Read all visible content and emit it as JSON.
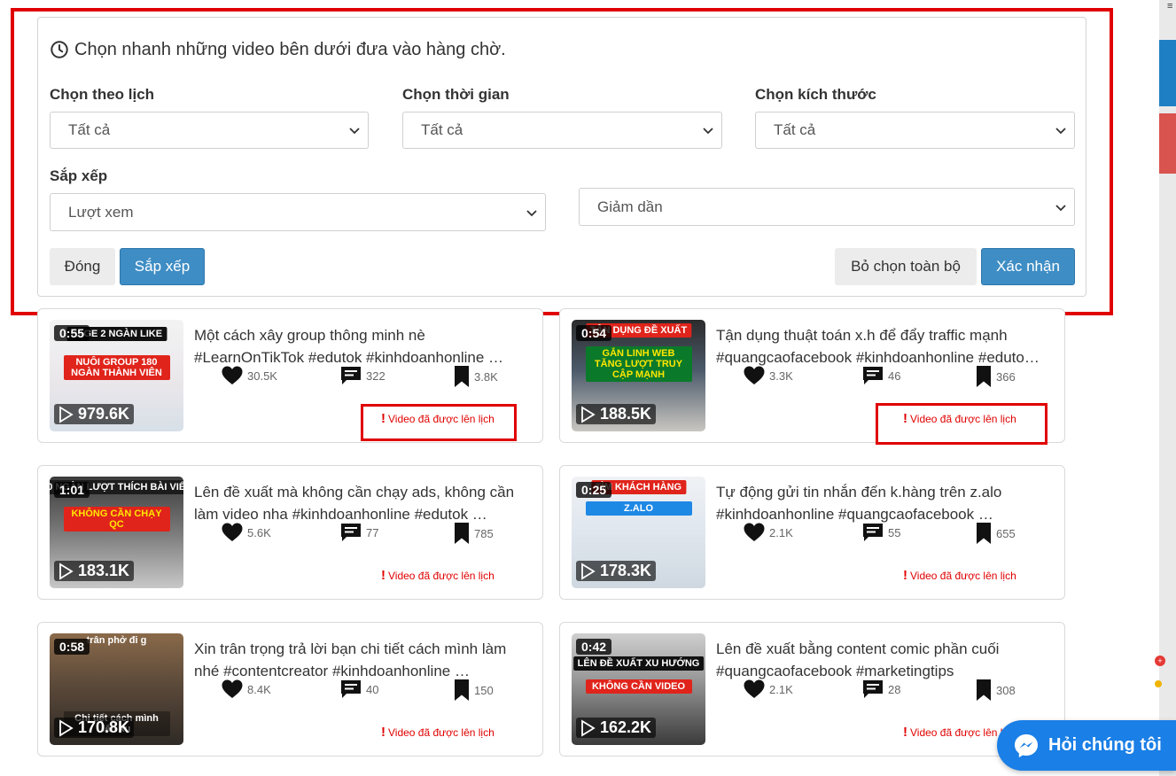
{
  "panel": {
    "title": "Chọn nhanh những video bên dưới đưa vào hàng chờ.",
    "filters": {
      "calendar_label": "Chọn theo lịch",
      "calendar_value": "Tất cả",
      "time_label": "Chọn thời gian",
      "time_value": "Tất cả",
      "size_label": "Chọn kích thước",
      "size_value": "Tất cả",
      "sort_label": "Sắp xếp",
      "sort_by_value": "Lượt xem",
      "sort_order_value": "Giảm dần"
    },
    "buttons": {
      "close": "Đóng",
      "sort": "Sắp xếp",
      "deselect_all": "Bỏ chọn toàn bộ",
      "confirm": "Xác nhận"
    }
  },
  "videos": [
    {
      "duration": "0:55",
      "views": "979.6K",
      "title_line1": "Một cách xây group thông minh nè",
      "title_line2": "#LearnOnTikTok #edutok #kinhdoanhonline …",
      "likes": "30.5K",
      "comments": "322",
      "saves": "3.8K",
      "status": "Video đã được lên lịch",
      "overlay_top": "PAGE 2 NGÀN LIKE",
      "overlay_mid": "NUÔI GROUP 180 NGÀN THÀNH VIÊN"
    },
    {
      "duration": "0:54",
      "views": "188.5K",
      "title_line1": "Tận dụng thuật toán x.h để đẩy traffic mạnh",
      "title_line2": "#quangcaofacebook #kinhdoanhonline #eduto…",
      "likes": "3.3K",
      "comments": "46",
      "saves": "366",
      "status": "Video đã được lên lịch",
      "overlay_top": "TẬN DỤNG ĐỀ XUẤT",
      "overlay_mid": "GẮN LINH WEB TĂNG LƯỢT TRUY CẬP MẠNH"
    },
    {
      "duration": "1:01",
      "views": "183.1K",
      "title_line1": "Lên đề xuất mà không cần chạy ads, không cần",
      "title_line2": "làm video nha #kinhdoanhonline #edutok …",
      "likes": "5.6K",
      "comments": "77",
      "saves": "785",
      "status": "Video đã được lên lịch",
      "overlay_top": "50 NGÀN LƯỢT THÍCH BÀI VIẾT",
      "overlay_mid": "KHÔNG CẦN CHẠY QC"
    },
    {
      "duration": "0:25",
      "views": "178.3K",
      "title_line1": "Tự động gửi tin nhắn đến k.hàng trên z.alo",
      "title_line2": "#kinhdoanhonline #quangcaofacebook …",
      "likes": "2.1K",
      "comments": "55",
      "saves": "655",
      "status": "Video đã được lên lịch",
      "overlay_top": "TÌM KHÁCH HÀNG",
      "overlay_mid": "Z.ALO"
    },
    {
      "duration": "0:58",
      "views": "170.8K",
      "title_line1": "Xin trân trọng trả lời bạn chi tiết cách mình làm",
      "title_line2": "nhé #contentcreator #kinhdoanhonline …",
      "likes": "8.4K",
      "comments": "40",
      "saves": "150",
      "status": "Video đã được lên lịch",
      "overlay_top": "trân phở đi g",
      "overlay_mid": "Chi tiết cách mình lên xu"
    },
    {
      "duration": "0:42",
      "views": "162.2K",
      "title_line1": "Lên đề xuất bằng content comic phần cuối",
      "title_line2": "#quangcaofacebook #marketingtips",
      "likes": "2.1K",
      "comments": "28",
      "saves": "308",
      "status": "Video đã được lên lịch",
      "overlay_top": "LÊN ĐỀ XUẤT XU HƯỚNG",
      "overlay_mid": "KHÔNG CẦN VIDEO"
    }
  ],
  "chat": {
    "label": "Hỏi chúng tôi"
  },
  "colors": {
    "accent_blue": "#3e8dc4",
    "highlight_red": "#e00000",
    "chat_blue": "#1a7fe6"
  }
}
